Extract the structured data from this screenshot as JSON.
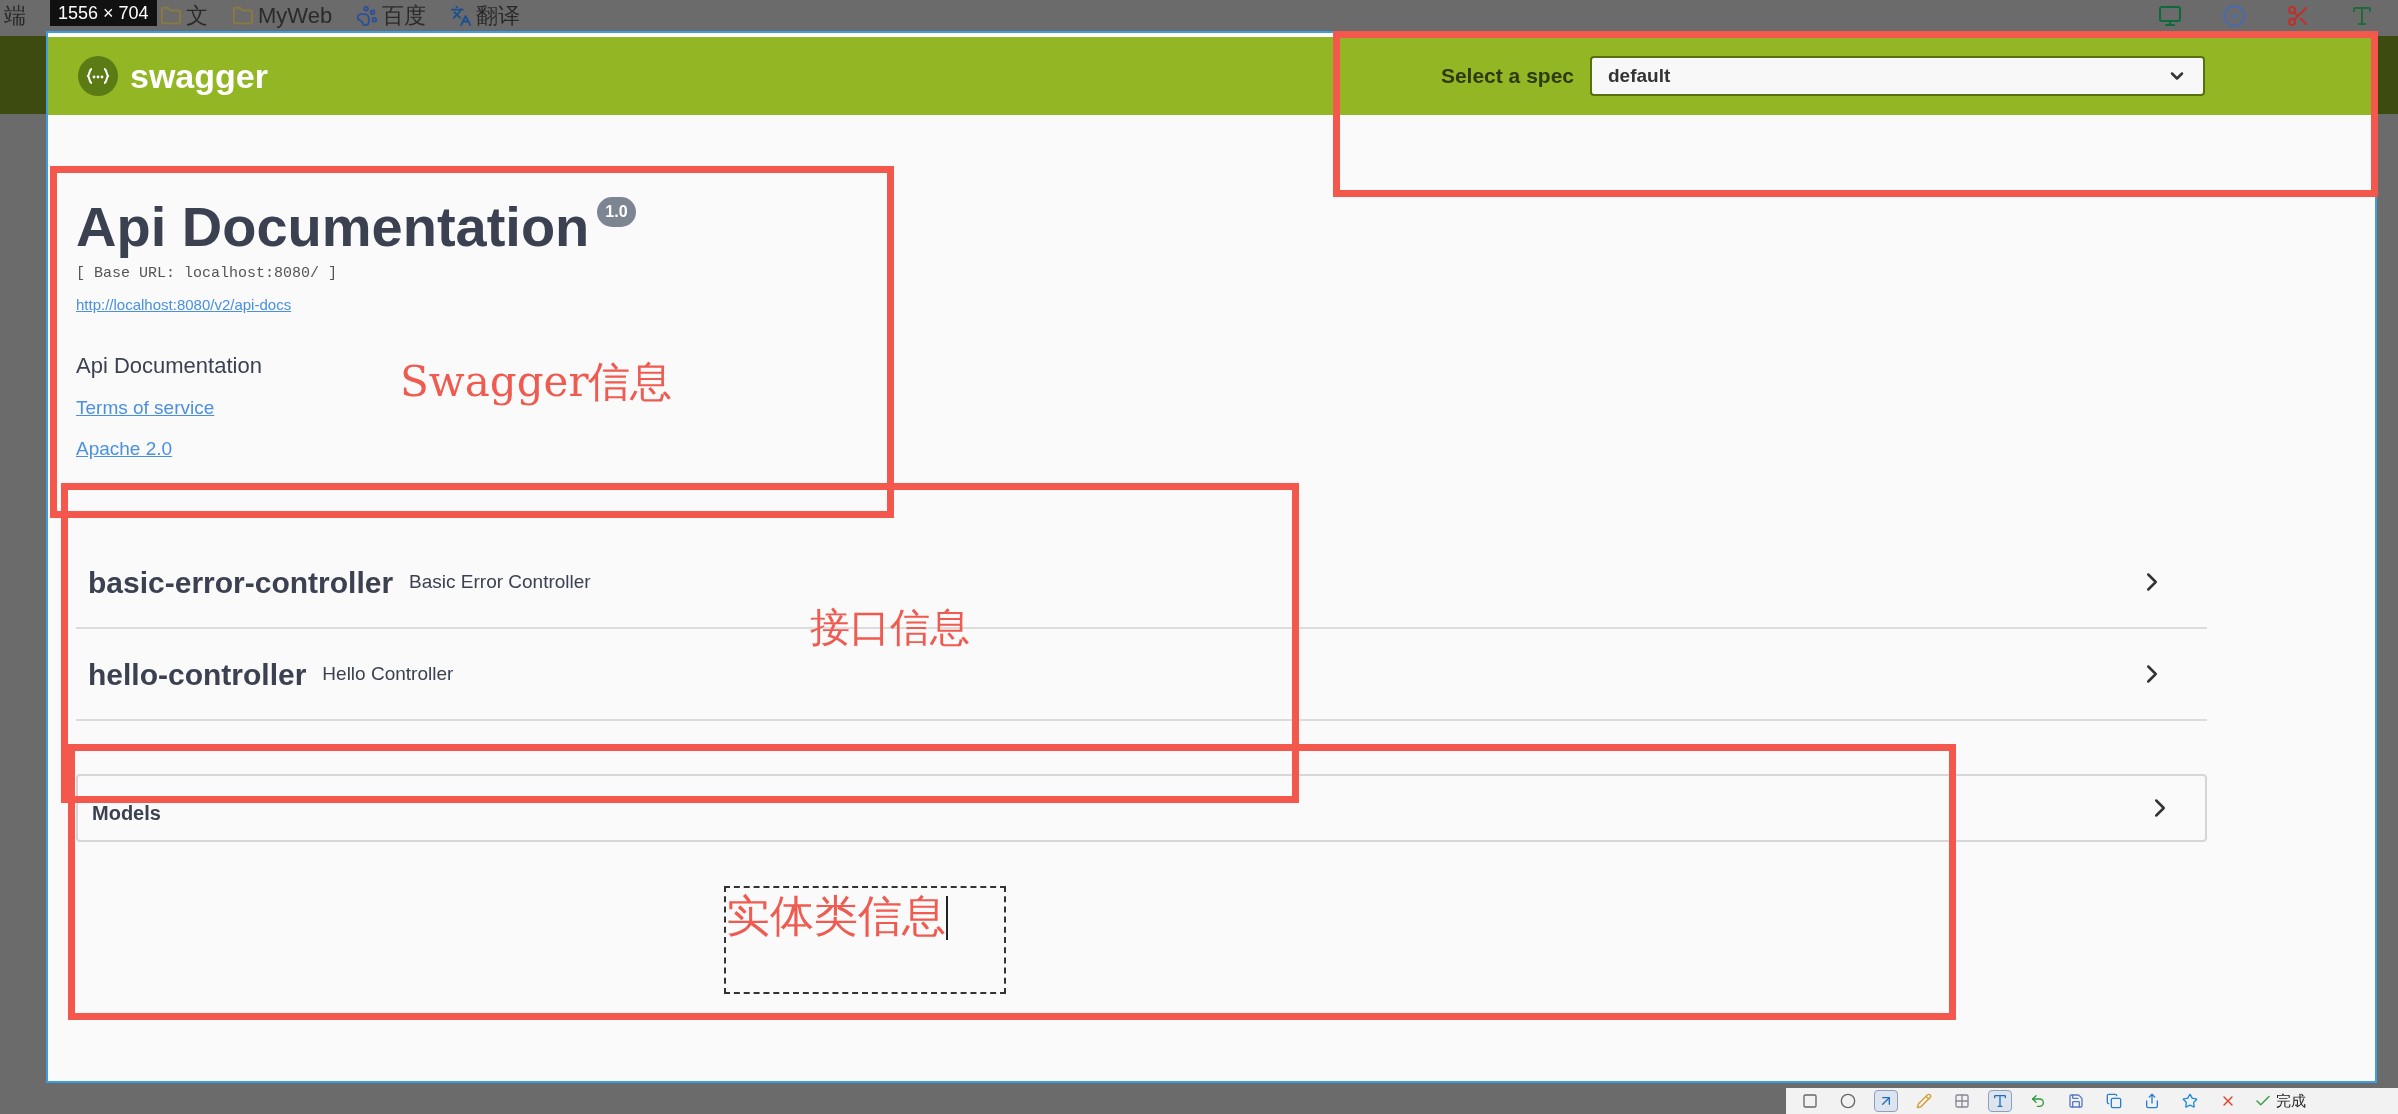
{
  "capture": {
    "size_label": "1556 × 704"
  },
  "browser_bookmarks": [
    {
      "label": "端",
      "kind": "text"
    },
    {
      "label": "文",
      "kind": "folder"
    },
    {
      "label": "MyWeb",
      "kind": "folder"
    },
    {
      "label": "百度",
      "kind": "paw"
    },
    {
      "label": "翻译",
      "kind": "translate"
    }
  ],
  "header": {
    "brand": "swagger",
    "spec_label": "Select a spec",
    "spec_value": "default"
  },
  "info": {
    "title": "Api Documentation",
    "version": "1.0",
    "base_url": "[ Base URL: localhost:8080/ ]",
    "docs_link": "http://localhost:8080/v2/api-docs",
    "description": "Api Documentation",
    "links": [
      "Terms of service",
      "Apache 2.0"
    ]
  },
  "tags": [
    {
      "name": "basic-error-controller",
      "description": "Basic Error Controller",
      "expanded": false
    },
    {
      "name": "hello-controller",
      "description": "Hello Controller",
      "expanded": false
    }
  ],
  "models": {
    "title": "Models",
    "expanded": false
  },
  "annotations": [
    {
      "text": "Swagger信息"
    },
    {
      "text": "接口信息"
    },
    {
      "text": "实体类信息"
    }
  ],
  "toolbar": {
    "tools": [
      {
        "kind": "rect",
        "selected": false
      },
      {
        "kind": "ellipse",
        "selected": false
      },
      {
        "kind": "arrow",
        "selected": true
      },
      {
        "kind": "pen",
        "selected": false
      },
      {
        "kind": "mosaic",
        "selected": false
      },
      {
        "kind": "text",
        "selected": true
      },
      {
        "kind": "undo",
        "selected": false
      },
      {
        "kind": "save",
        "selected": false
      },
      {
        "kind": "copy",
        "selected": false
      },
      {
        "kind": "share",
        "selected": false
      },
      {
        "kind": "pin",
        "selected": false
      },
      {
        "kind": "cancel",
        "selected": false
      }
    ],
    "done_label": "完成"
  }
}
